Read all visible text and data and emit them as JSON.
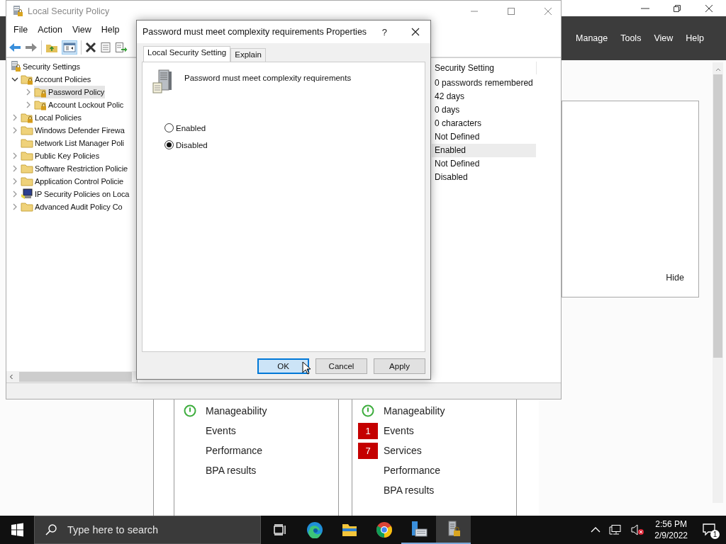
{
  "server_manager": {
    "menu": [
      "Manage",
      "Tools",
      "View",
      "Help"
    ],
    "hide_link": "Hide",
    "tiles": [
      {
        "rows": [
          {
            "kind": "ok",
            "label": "Manageability"
          },
          {
            "kind": "plain",
            "label": "Events"
          },
          {
            "kind": "plain",
            "label": "Performance"
          },
          {
            "kind": "plain",
            "label": "BPA results"
          }
        ]
      },
      {
        "rows": [
          {
            "kind": "ok",
            "label": "Manageability"
          },
          {
            "kind": "alert",
            "count": "1",
            "label": "Events"
          },
          {
            "kind": "alert",
            "count": "7",
            "label": "Services"
          },
          {
            "kind": "plain",
            "label": "Performance"
          },
          {
            "kind": "plain",
            "label": "BPA results"
          }
        ]
      }
    ]
  },
  "policy_window": {
    "title": "Local Security Policy",
    "menu": [
      "File",
      "Action",
      "View",
      "Help"
    ],
    "tree": [
      {
        "label": "Security Settings",
        "kind": "root",
        "expandable": false,
        "selected": false,
        "children": [
          {
            "label": "Account Policies",
            "kind": "locked-folder",
            "expandable": true,
            "expanded": true,
            "selected": false,
            "children": [
              {
                "label": "Password Policy",
                "kind": "locked-folder",
                "expandable": true,
                "expanded": false,
                "selected": true
              },
              {
                "label": "Account Lockout Polic",
                "kind": "locked-folder",
                "expandable": true,
                "expanded": false,
                "selected": false
              }
            ]
          },
          {
            "label": "Local Policies",
            "kind": "locked-folder",
            "expandable": true,
            "expanded": false,
            "selected": false
          },
          {
            "label": "Windows Defender Firewa",
            "kind": "folder",
            "expandable": true,
            "expanded": false,
            "selected": false
          },
          {
            "label": "Network List Manager Poli",
            "kind": "folder",
            "expandable": false,
            "selected": false
          },
          {
            "label": "Public Key Policies",
            "kind": "folder",
            "expandable": true,
            "expanded": false,
            "selected": false
          },
          {
            "label": "Software Restriction Policie",
            "kind": "folder",
            "expandable": true,
            "expanded": false,
            "selected": false
          },
          {
            "label": "Application Control Policie",
            "kind": "folder",
            "expandable": true,
            "expanded": false,
            "selected": false
          },
          {
            "label": "IP Security Policies on Loca",
            "kind": "ip-security",
            "expandable": true,
            "expanded": false,
            "selected": false
          },
          {
            "label": "Advanced Audit Policy Co",
            "kind": "folder",
            "expandable": true,
            "expanded": false,
            "selected": false
          }
        ]
      }
    ],
    "column": "Security Setting",
    "rows": [
      {
        "value": "0 passwords remembered",
        "selected": false
      },
      {
        "value": "42 days",
        "selected": false
      },
      {
        "value": "0 days",
        "selected": false
      },
      {
        "value": "0 characters",
        "selected": false
      },
      {
        "value": "Not Defined",
        "selected": false
      },
      {
        "value": "Enabled",
        "selected": true
      },
      {
        "value": "Not Defined",
        "selected": false
      },
      {
        "value": "Disabled",
        "selected": false
      }
    ]
  },
  "dialog": {
    "title": "Password must meet complexity requirements Properties",
    "help": "?",
    "tabs": [
      {
        "label": "Local Security Setting",
        "selected": true
      },
      {
        "label": "Explain",
        "selected": false
      }
    ],
    "policy_name": "Password must meet complexity requirements",
    "options": [
      {
        "label": "Enabled",
        "selected": false
      },
      {
        "label": "Disabled",
        "selected": true
      }
    ],
    "buttons": [
      {
        "label": "OK",
        "kind": "default"
      },
      {
        "label": "Cancel",
        "kind": "normal"
      },
      {
        "label": "Apply",
        "kind": "normal"
      }
    ]
  },
  "taskbar": {
    "search": {
      "placeholder": "Type here to search"
    },
    "apps": [
      {
        "kind": "task-view",
        "running": false,
        "active": false
      },
      {
        "kind": "edge",
        "running": false,
        "active": false
      },
      {
        "kind": "explorer",
        "running": false,
        "active": false
      },
      {
        "kind": "chrome",
        "running": false,
        "active": false
      },
      {
        "kind": "server-manager",
        "running": true,
        "active": false
      },
      {
        "kind": "security-policy",
        "running": true,
        "active": true
      }
    ],
    "time": "2:56 PM",
    "date": "2/9/2022",
    "notifications": "1"
  }
}
